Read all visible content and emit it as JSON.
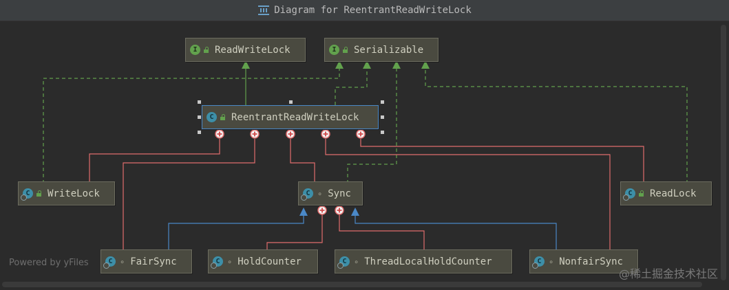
{
  "window": {
    "title": "Diagram for ReentrantReadWriteLock"
  },
  "nodes": {
    "readwritelock": {
      "label": "ReadWriteLock",
      "kind": "interface"
    },
    "serializable": {
      "label": "Serializable",
      "kind": "interface"
    },
    "reentrantreadwritelock": {
      "label": "ReentrantReadWriteLock",
      "kind": "class"
    },
    "writelock": {
      "label": "WriteLock",
      "kind": "inner-class"
    },
    "sync": {
      "label": "Sync",
      "kind": "inner-abstract-class"
    },
    "readlock": {
      "label": "ReadLock",
      "kind": "inner-class"
    },
    "fairsync": {
      "label": "FairSync",
      "kind": "inner-class"
    },
    "holdcounter": {
      "label": "HoldCounter",
      "kind": "inner-class"
    },
    "threadlocalholdcounter": {
      "label": "ThreadLocalHoldCounter",
      "kind": "inner-class"
    },
    "nonfairsync": {
      "label": "NonfairSync",
      "kind": "inner-class"
    }
  },
  "watermarks": {
    "yfiles": "Powered by yFiles",
    "juejin": "@稀土掘金技术社区"
  },
  "colors": {
    "implements": "#62a14d",
    "extends": "#4a88c7",
    "inner": "#e06c6c",
    "node_bg": "#4a4a40"
  }
}
